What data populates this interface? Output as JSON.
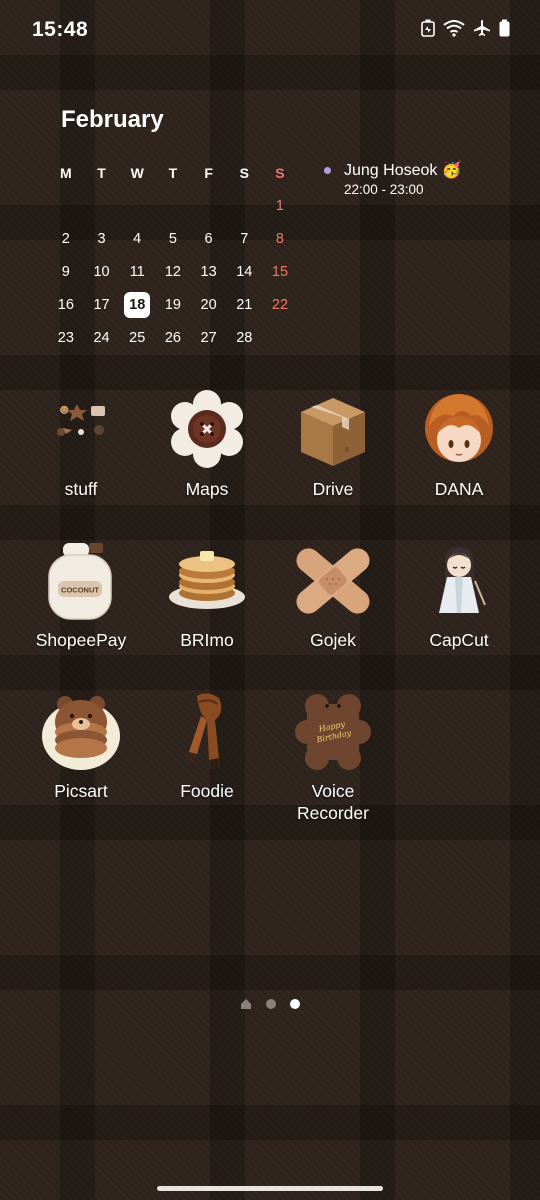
{
  "status_bar": {
    "time": "15:48",
    "icons": [
      "battery-saver-icon",
      "wifi-icon",
      "airplane-icon",
      "battery-icon"
    ]
  },
  "calendar": {
    "month": "February",
    "weekdays": [
      "M",
      "T",
      "W",
      "T",
      "F",
      "S",
      "S"
    ],
    "weeks": [
      [
        "",
        "",
        "",
        "",
        "",
        "",
        "1"
      ],
      [
        "2",
        "3",
        "4",
        "5",
        "6",
        "7",
        "8"
      ],
      [
        "9",
        "10",
        "11",
        "12",
        "13",
        "14",
        "15"
      ],
      [
        "16",
        "17",
        "18",
        "19",
        "20",
        "21",
        "22"
      ],
      [
        "23",
        "24",
        "25",
        "26",
        "27",
        "28",
        ""
      ]
    ],
    "today": "18",
    "sunday_color": "#f07a6a",
    "event": {
      "title": "Jung Hoseok 🥳",
      "time": "22:00 - 23:00",
      "dot_color": "#b79ae6"
    }
  },
  "apps": [
    {
      "label": "stuff",
      "icon": "folder-stickers-icon"
    },
    {
      "label": "Maps",
      "icon": "flower-button-icon"
    },
    {
      "label": "Drive",
      "icon": "cardboard-box-icon"
    },
    {
      "label": "DANA",
      "icon": "orange-hair-figure-icon"
    },
    {
      "label": "ShopeePay",
      "icon": "coconut-jar-icon"
    },
    {
      "label": "BRImo",
      "icon": "pancake-stack-icon"
    },
    {
      "label": "Gojek",
      "icon": "bandage-cross-icon"
    },
    {
      "label": "CapCut",
      "icon": "figurine-icon"
    },
    {
      "label": "Picsart",
      "icon": "bear-pancake-icon"
    },
    {
      "label": "Foodie",
      "icon": "scarf-icon"
    },
    {
      "label": "Voice Recorder",
      "icon": "birthday-cookie-icon"
    }
  ],
  "cookie_text": "Happy Birthday",
  "jar_text": "COCONUT",
  "page_indicator": {
    "pages": 3,
    "current": 3
  }
}
